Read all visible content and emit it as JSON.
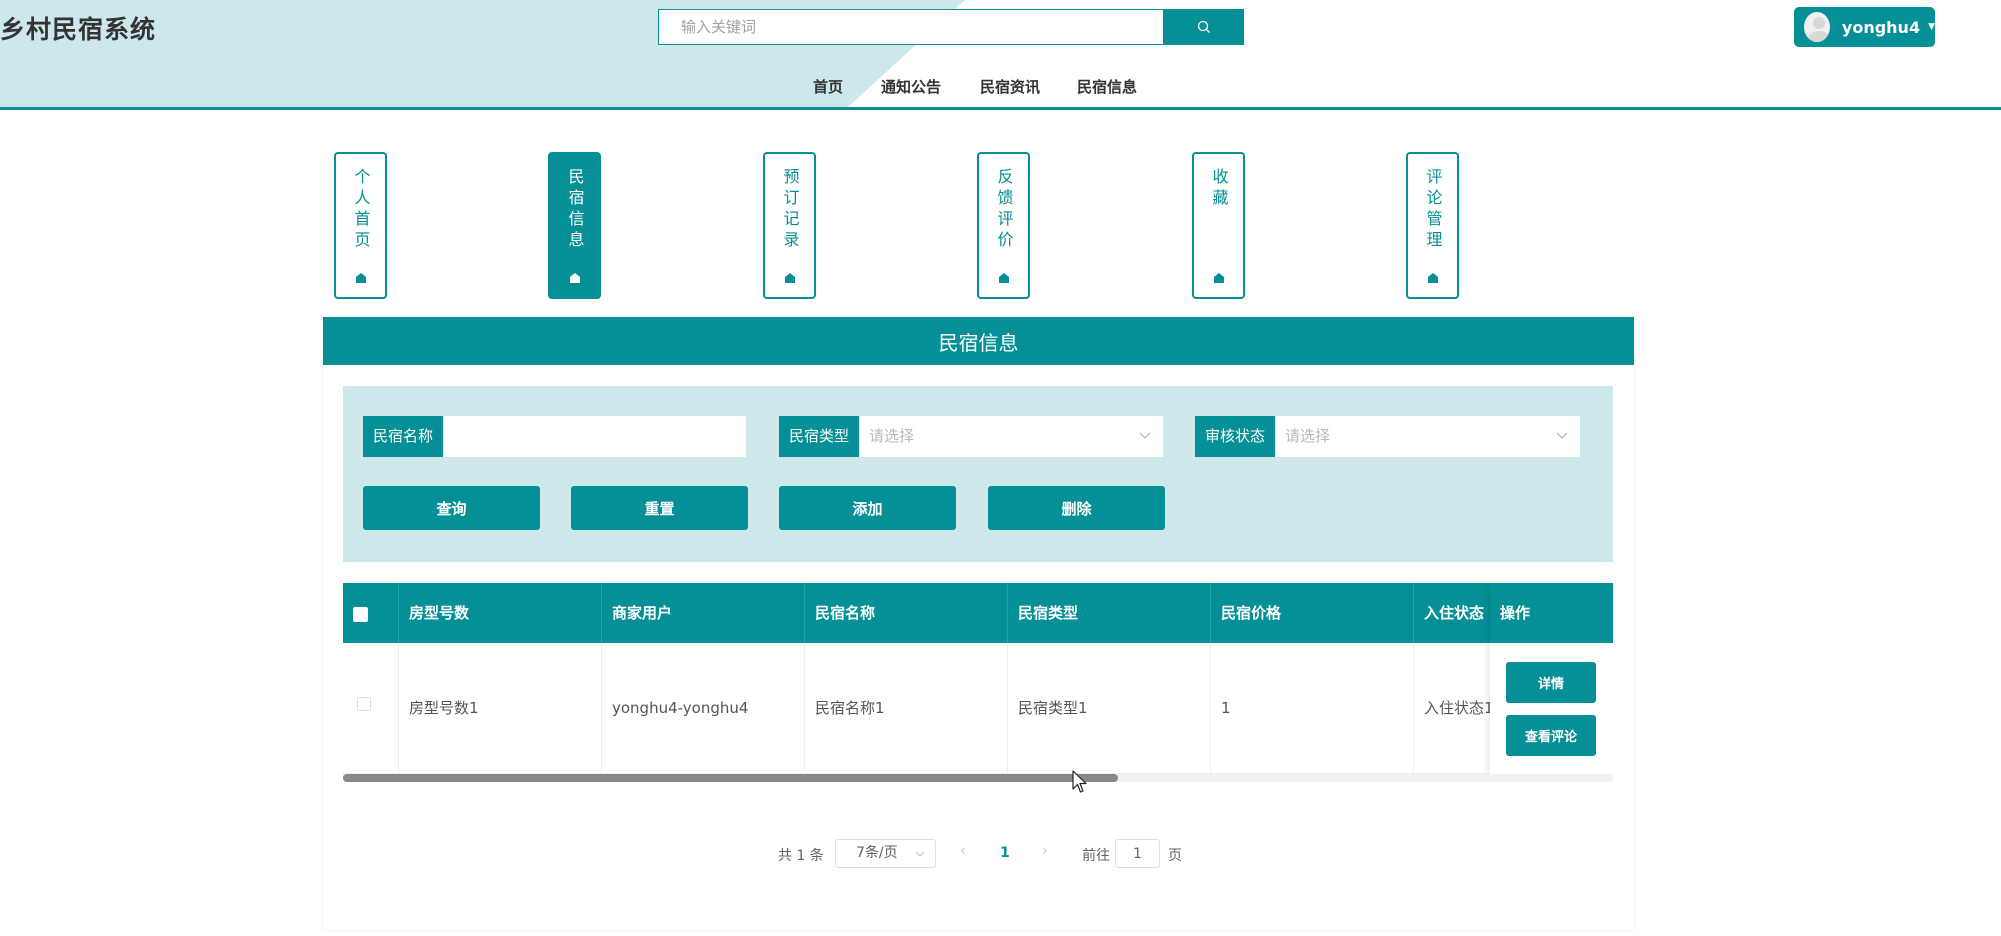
{
  "header": {
    "site_title": "乡村民宿系统",
    "search_placeholder": "输入关键词",
    "user_name": "yonghu4",
    "nav": [
      "首页",
      "通知公告",
      "民宿资讯",
      "民宿信息"
    ]
  },
  "menu_tabs": [
    {
      "label": "个人首页",
      "active": false
    },
    {
      "label": "民宿信息",
      "active": true
    },
    {
      "label": "预订记录",
      "active": false
    },
    {
      "label": "反馈评价",
      "active": false
    },
    {
      "label": "收藏",
      "active": false
    },
    {
      "label": "评论管理",
      "active": false
    }
  ],
  "panel": {
    "title": "民宿信息",
    "filters": {
      "name_label": "民宿名称",
      "name_value": "",
      "type_label": "民宿类型",
      "type_placeholder": "请选择",
      "status_label": "审核状态",
      "status_placeholder": "请选择"
    },
    "buttons": {
      "query": "查询",
      "reset": "重置",
      "add": "添加",
      "delete": "删除"
    },
    "table": {
      "columns": [
        "房型号数",
        "商家用户",
        "民宿名称",
        "民宿类型",
        "民宿价格",
        "入住状态",
        "操作"
      ],
      "rows": [
        {
          "room_count": "房型号数1",
          "merchant": "yonghu4-yonghu4",
          "name": "民宿名称1",
          "type": "民宿类型1",
          "price": "1",
          "checkin_status": "入住状态1",
          "detail_label": "详情",
          "comments_label": "查看评论"
        }
      ]
    },
    "pagination": {
      "total": "共 1 条",
      "page_size": "7条/页",
      "current_page": "1",
      "goto_label": "前往",
      "goto_value": "1",
      "goto_unit": "页"
    },
    "scrollbar_fraction": 0.61
  },
  "colors": {
    "primary": "#058f96",
    "light": "#cce8eb"
  }
}
